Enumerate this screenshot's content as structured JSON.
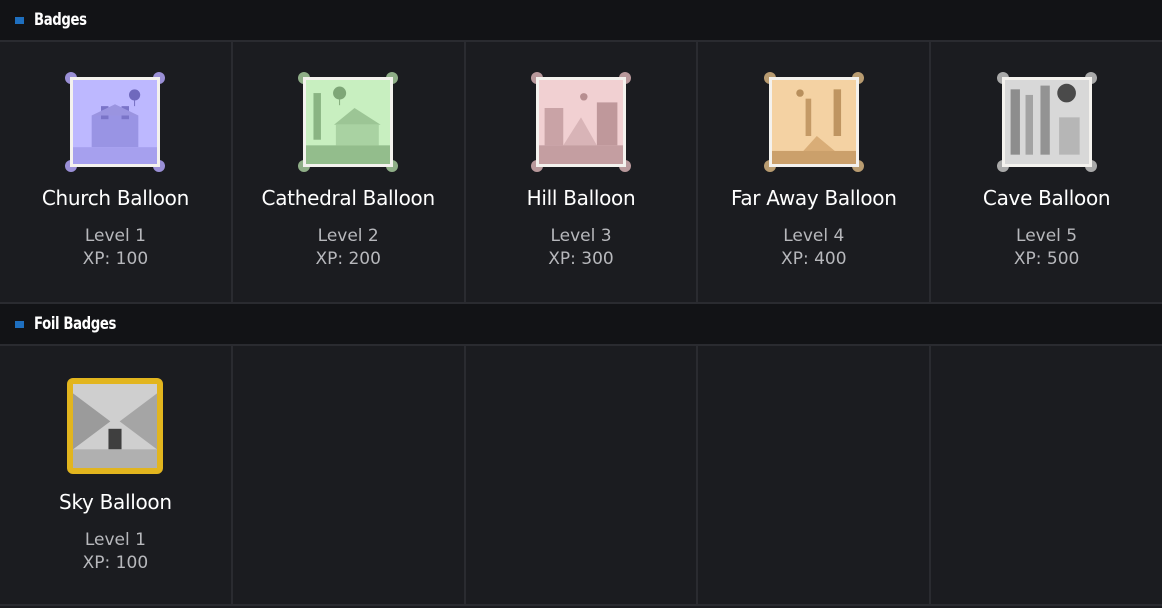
{
  "sections": [
    {
      "title": "Badges",
      "badges": [
        {
          "name": "Church Balloon",
          "level": "Level 1",
          "xp": "XP: 100",
          "tint": "#b9b4ff",
          "corner": "#9a8fd6"
        },
        {
          "name": "Cathedral Balloon",
          "level": "Level 2",
          "xp": "XP: 200",
          "tint": "#bfe8b8",
          "corner": "#8fae87"
        },
        {
          "name": "Hill Balloon",
          "level": "Level 3",
          "xp": "XP: 300",
          "tint": "#f0c7c9",
          "corner": "#b8989b"
        },
        {
          "name": "Far Away Balloon",
          "level": "Level 4",
          "xp": "XP: 400",
          "tint": "#f1c48a",
          "corner": "#b89b70"
        },
        {
          "name": "Cave Balloon",
          "level": "Level 5",
          "xp": "XP: 500",
          "tint": "#d9d9d9",
          "corner": "#a9a9a9"
        }
      ]
    },
    {
      "title": "Foil Badges",
      "badges": [
        {
          "name": "Sky Balloon",
          "level": "Level 1",
          "xp": "XP: 100",
          "tint": "#cfcfcf",
          "frame": "#e2b51e"
        }
      ]
    }
  ],
  "colors": {
    "accent": "#1e6fbf",
    "background": "#1b1c20",
    "header_bg": "#121316"
  }
}
